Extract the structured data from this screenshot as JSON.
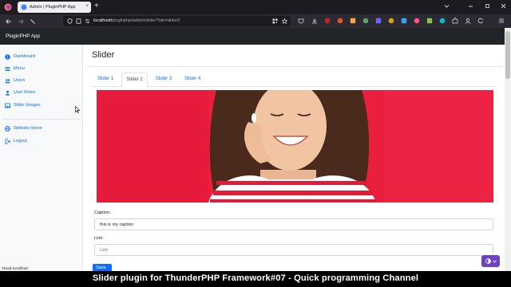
{
  "browser": {
    "tab_title": "Admin | PluginPHP App",
    "tab_close": "×",
    "new_tab": "+",
    "url_host": "localhost/",
    "url_path": "pluginphp/admin/slider?tab=slider2"
  },
  "app": {
    "brand": "PluginPHP App",
    "page_title": "Slider"
  },
  "sidebar": {
    "items": [
      {
        "label": "Dashboard",
        "icon": "info-circle-icon"
      },
      {
        "label": "Menu",
        "icon": "list-icon"
      },
      {
        "label": "Users",
        "icon": "users-icon"
      },
      {
        "label": "User Roles",
        "icon": "user-roles-icon"
      },
      {
        "label": "Slider Images",
        "icon": "image-icon"
      },
      {
        "label": "Website Home",
        "icon": "globe-icon"
      },
      {
        "label": "Logout",
        "icon": "logout-icon"
      }
    ]
  },
  "tabs": [
    {
      "label": "Slider 1",
      "active": false
    },
    {
      "label": "Slider 2",
      "active": true
    },
    {
      "label": "Slider 3",
      "active": false
    },
    {
      "label": "Slider 4",
      "active": false
    }
  ],
  "form": {
    "caption_label": "Caption:",
    "caption_value": "this is my caption",
    "link_label": "Link:",
    "link_placeholder": "Link",
    "save_label": "Save"
  },
  "status_text": "Read localhost",
  "video_caption": "Slider plugin for ThunderPHP Framework#07 -  Quick programming Channel",
  "colors": {
    "accent": "#0d6efd",
    "appbar": "#212529",
    "slider_bg": "#ea1f3d",
    "theme_button": "#6f42c1"
  }
}
